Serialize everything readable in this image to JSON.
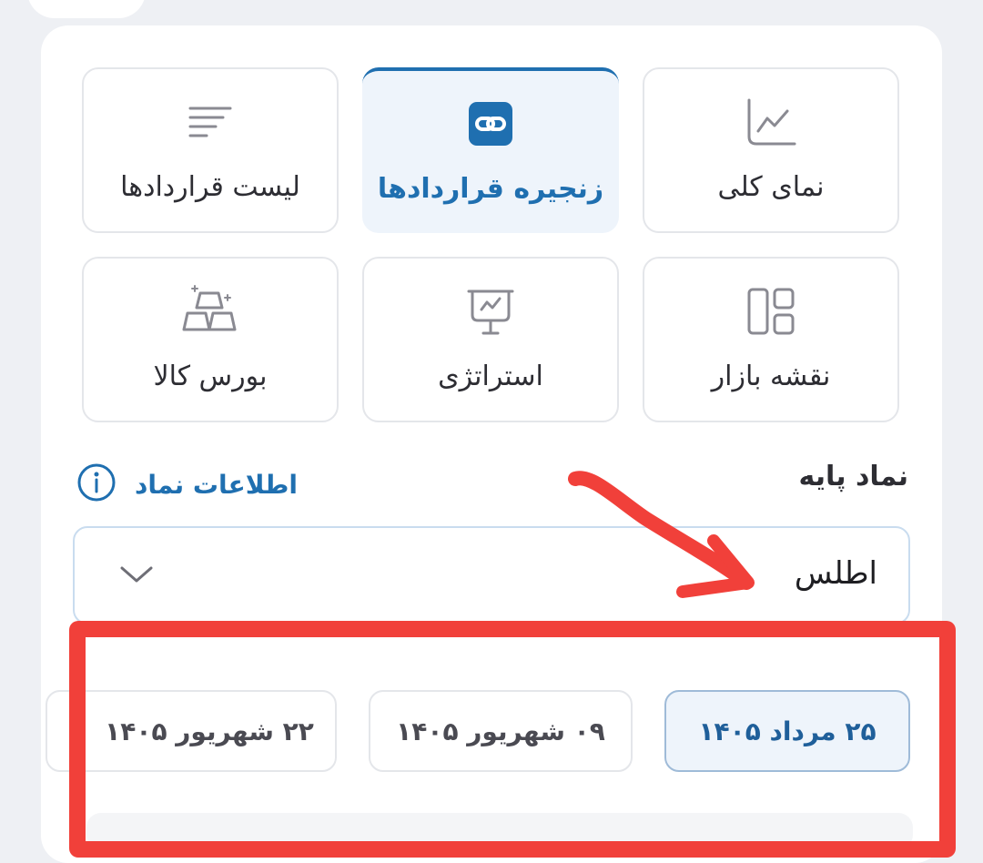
{
  "tiles": [
    {
      "label": "لیست قراردادها",
      "icon": "sort-lines-icon"
    },
    {
      "label": "زنجیره قراردادها",
      "icon": "link-chain-icon",
      "active": true
    },
    {
      "label": "نمای کلی",
      "icon": "line-chart-icon"
    },
    {
      "label": "بورس کالا",
      "icon": "gold-bars-icon"
    },
    {
      "label": "استراتژی",
      "icon": "presentation-board-icon"
    },
    {
      "label": "نقشه بازار",
      "icon": "grid-layout-icon"
    }
  ],
  "base_symbol": {
    "label": "نماد پایه",
    "info_link": "اطلاعات نماد",
    "selected_value": "اطلس"
  },
  "dates": [
    {
      "label": "۲۵ مرداد ۱۴۰۵",
      "active": true
    },
    {
      "label": "۰۹ شهریور ۱۴۰۵",
      "active": false
    },
    {
      "label": "۲۲ شهریور ۱۴۰۵",
      "active": false
    }
  ],
  "colors": {
    "accent": "#1f6fb0",
    "annotation_red": "#f1403a",
    "background": "#eef0f4"
  }
}
